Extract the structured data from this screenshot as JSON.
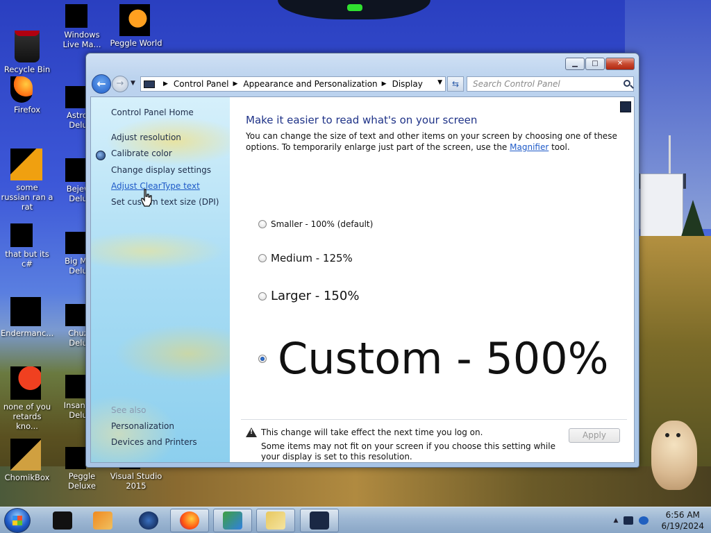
{
  "desktop": {
    "icons": [
      {
        "label": "Recycle Bin"
      },
      {
        "label": "Windows Live Ma..."
      },
      {
        "label": "Peggle World"
      },
      {
        "label": "Firefox"
      },
      {
        "label": "Astrol... Delu..."
      },
      {
        "label": "some russian ran a rat"
      },
      {
        "label": "Bejew... Delu..."
      },
      {
        "label": "that but its c#"
      },
      {
        "label": "Big Mo... Delu..."
      },
      {
        "label": "Endermanc..."
      },
      {
        "label": "Chuz... Delu..."
      },
      {
        "label": "none of you retards kno..."
      },
      {
        "label": "Insaniq... Delu..."
      },
      {
        "label": "ChomikBox"
      },
      {
        "label": "Peggle Deluxe"
      },
      {
        "label": "Visual Studio 2015"
      }
    ]
  },
  "window": {
    "controls": {
      "minimize": "▁",
      "maximize": "□",
      "close": "✕"
    },
    "breadcrumb": [
      "Control Panel",
      "Appearance and Personalization",
      "Display"
    ],
    "search_placeholder": "Search Control Panel"
  },
  "leftpane": {
    "home": "Control Panel Home",
    "links": [
      "Adjust resolution",
      "Calibrate color",
      "Change display settings",
      "Adjust ClearType text",
      "Set custom text size (DPI)"
    ],
    "see_also_label": "See also",
    "see_also": [
      "Personalization",
      "Devices and Printers"
    ]
  },
  "main": {
    "title": "Make it easier to read what's on your screen",
    "desc_before": "You can change the size of text and other items on your screen by choosing one of these options. To temporarily enlarge just part of the screen, use the ",
    "desc_link": "Magnifier",
    "desc_after": " tool.",
    "options": [
      {
        "label": "Smaller - 100% (default)",
        "checked": false
      },
      {
        "label": "Medium - 125%",
        "checked": false
      },
      {
        "label": "Larger - 150%",
        "checked": false
      },
      {
        "label": "Custom - 500%",
        "checked": true
      }
    ],
    "warning": "This change will take effect the next time you log on.",
    "note": "Some items may not fit on your screen if you choose this setting while your display is set to this resolution.",
    "apply_label": "Apply"
  },
  "taskbar": {
    "time": "6:56 AM",
    "date": "6/19/2024"
  }
}
